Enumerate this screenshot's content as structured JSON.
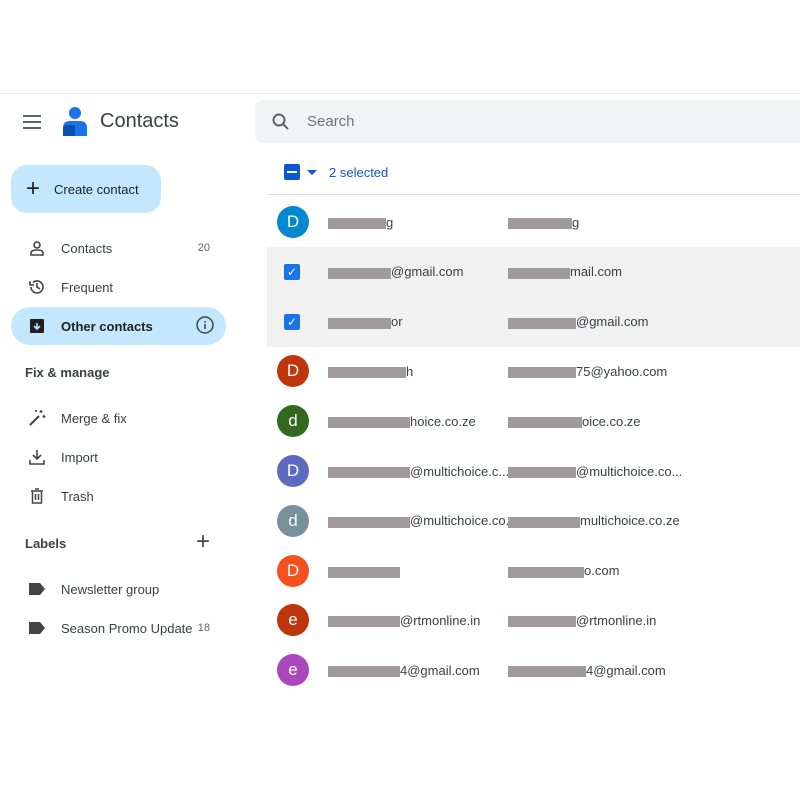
{
  "app": {
    "title": "Contacts",
    "menu_icon": "hamburger-icon",
    "logo_icon": "contacts-logo-icon"
  },
  "search": {
    "placeholder": "Search"
  },
  "sidebar": {
    "create_label": "Create contact",
    "items": [
      {
        "label": "Contacts",
        "count": "20",
        "icon": "person-icon"
      },
      {
        "label": "Frequent",
        "count": "",
        "icon": "history-icon"
      },
      {
        "label": "Other contacts",
        "count": "",
        "icon": "archive-download-icon",
        "active": true
      }
    ],
    "fix_heading": "Fix & manage",
    "fix_items": [
      {
        "label": "Merge & fix",
        "icon": "magic-wand-icon"
      },
      {
        "label": "Import",
        "icon": "download-icon"
      },
      {
        "label": "Trash",
        "icon": "trash-icon"
      }
    ],
    "labels_heading": "Labels",
    "labels": [
      {
        "label": "Newsletter group",
        "count": ""
      },
      {
        "label": "Season Promo Update",
        "count": "18"
      }
    ]
  },
  "toolbar": {
    "selected_label": "2 selected"
  },
  "colors": {
    "accent": "#0b57d0",
    "active_bg": "#c2e7ff"
  },
  "contacts": [
    {
      "initial": "D",
      "color": "#0288d1",
      "selected": false,
      "name": "g",
      "email": "g"
    },
    {
      "initial": "",
      "color": "",
      "selected": true,
      "name": "@gmail.com",
      "email": "mail.com"
    },
    {
      "initial": "",
      "color": "",
      "selected": true,
      "name": "or",
      "email": "@gmail.com"
    },
    {
      "initial": "D",
      "color": "#bf360c",
      "selected": false,
      "name": "h",
      "email": "75@yahoo.com"
    },
    {
      "initial": "d",
      "color": "#33691e",
      "selected": false,
      "name": "hoice.co.ze",
      "email": "oice.co.ze"
    },
    {
      "initial": "D",
      "color": "#5c6bc0",
      "selected": false,
      "name": "@multichoice.c...",
      "email": "@multichoice.co..."
    },
    {
      "initial": "d",
      "color": "#78909c",
      "selected": false,
      "name": "@multichoice.co....",
      "email": "multichoice.co.ze"
    },
    {
      "initial": "D",
      "color": "#f4511e",
      "selected": false,
      "name": "",
      "email": "o.com"
    },
    {
      "initial": "e",
      "color": "#bf360c",
      "selected": false,
      "name": "@rtmonline.in",
      "email": "@rtmonline.in"
    },
    {
      "initial": "e",
      "color": "#ab47bc",
      "selected": false,
      "name": "4@gmail.com",
      "email": "4@gmail.com"
    }
  ]
}
